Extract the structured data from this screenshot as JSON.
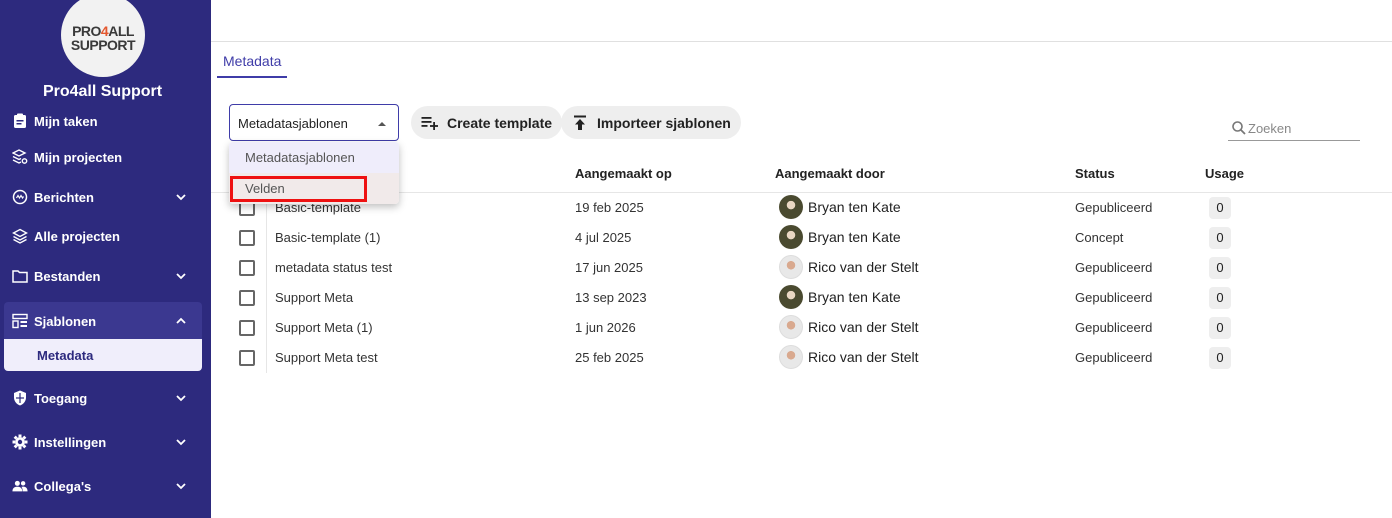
{
  "sidebar": {
    "logo": {
      "line1_a": "PRO",
      "line1_four": "4",
      "line1_b": "ALL",
      "line2": "SUPPORT"
    },
    "org_name": "Pro4all Support",
    "items": [
      {
        "label": "Mijn taken",
        "icon": "clipboard-icon"
      },
      {
        "label": "Mijn projecten",
        "icon": "layers-gear-icon"
      },
      {
        "label": "Berichten",
        "icon": "message-icon",
        "expandable": true
      },
      {
        "label": "Alle projecten",
        "icon": "layers-icon"
      },
      {
        "label": "Bestanden",
        "icon": "folder-icon",
        "expandable": true
      },
      {
        "label": "Sjablonen",
        "icon": "template-icon",
        "expandable": true,
        "expanded": true
      },
      {
        "label": "Toegang",
        "icon": "shield-icon",
        "expandable": true
      },
      {
        "label": "Instellingen",
        "icon": "gear-icon",
        "expandable": true
      },
      {
        "label": "Collega's",
        "icon": "people-icon",
        "expandable": true
      }
    ],
    "sub_item": "Metadata"
  },
  "tabs": [
    {
      "label": "Metadata",
      "active": true
    }
  ],
  "toolbar": {
    "select_value": "Metadatasjablonen",
    "create_label": "Create template",
    "import_label": "Importeer sjablonen",
    "search_placeholder": "Zoeken"
  },
  "dropdown": {
    "options": [
      "Metadatasjablonen",
      "Velden"
    ],
    "selected": "Metadatasjablonen",
    "highlighted": "Velden"
  },
  "table": {
    "columns": [
      "Aangemaakt op",
      "Aangemaakt door",
      "Status",
      "Usage"
    ],
    "rows": [
      {
        "name": "Basic-template",
        "date": "19 feb 2025",
        "user": "Bryan ten Kate",
        "avatar": "dark",
        "status": "Gepubliceerd",
        "usage": "0"
      },
      {
        "name": "Basic-template (1)",
        "date": "4 jul 2025",
        "user": "Bryan ten Kate",
        "avatar": "dark",
        "status": "Concept",
        "usage": "0"
      },
      {
        "name": "metadata status test",
        "date": "17 jun 2025",
        "user": "Rico van der Stelt",
        "avatar": "light",
        "status": "Gepubliceerd",
        "usage": "0"
      },
      {
        "name": "Support Meta",
        "date": "13 sep 2023",
        "user": "Bryan ten Kate",
        "avatar": "dark",
        "status": "Gepubliceerd",
        "usage": "0"
      },
      {
        "name": "Support Meta (1)",
        "date": "1 jun 2026",
        "user": "Rico van der Stelt",
        "avatar": "light",
        "status": "Gepubliceerd",
        "usage": "0"
      },
      {
        "name": "Support Meta test",
        "date": "25 feb 2025",
        "user": "Rico van der Stelt",
        "avatar": "light",
        "status": "Gepubliceerd",
        "usage": "0"
      }
    ]
  },
  "colors": {
    "sidebar": "#2d2a7e",
    "accent": "#3f3ca8",
    "highlight_border": "#ee1111"
  }
}
